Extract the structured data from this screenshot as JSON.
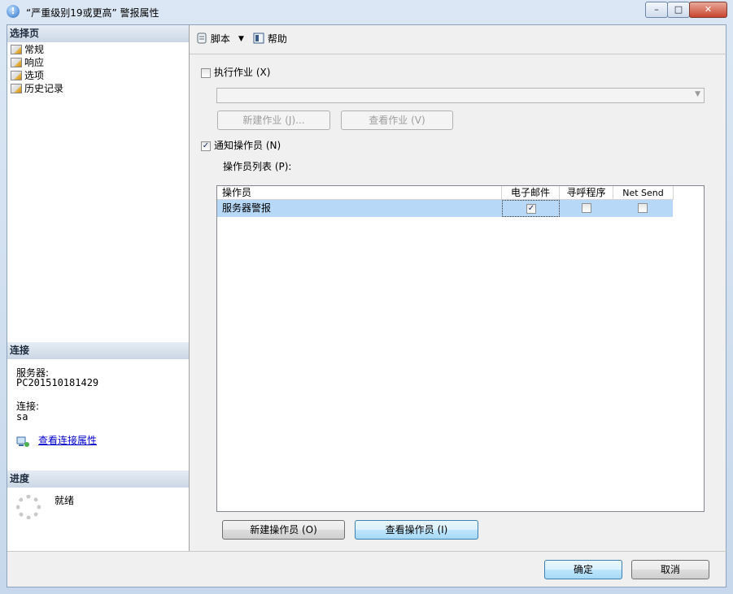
{
  "window": {
    "title": "“严重级别19或更高” 警报属性",
    "controls": {
      "minimize": "–",
      "maximize": "□",
      "close": "✕"
    }
  },
  "left_panel": {
    "select_page_header": "选择页",
    "pages": [
      {
        "label": "常规"
      },
      {
        "label": "响应"
      },
      {
        "label": "选项"
      },
      {
        "label": "历史记录"
      }
    ],
    "connection_header": "连接",
    "server_label": "服务器:",
    "server_value": "PC201510181429",
    "connection_label": "连接:",
    "connection_value": "sa",
    "view_connection_properties": "查看连接属性",
    "progress_header": "进度",
    "progress_status": "就绪"
  },
  "toolbar": {
    "script_label": "脚本",
    "help_label": "帮助",
    "icons": [
      "script-icon",
      "help-icon"
    ]
  },
  "response": {
    "execute_job_label": "执行作业 (X)",
    "execute_job_checked": false,
    "job_combo_value": "",
    "new_job_button": "新建作业 (J)...",
    "view_job_button": "查看作业 (V)",
    "notify_operators_label": "通知操作员 (N)",
    "notify_operators_checked": true,
    "operator_list_label": "操作员列表 (P):",
    "columns": [
      "操作员",
      "电子邮件",
      "寻呼程序",
      "Net Send"
    ],
    "rows": [
      {
        "operator": "服务器警报",
        "email": true,
        "pager": false,
        "net_send": false
      }
    ],
    "new_operator_button": "新建操作员 (O)",
    "view_operator_button": "查看操作员 (I)"
  },
  "footer": {
    "ok_button": "确定",
    "cancel_button": "取消"
  },
  "colors": {
    "selected_row": "#b7d8f7",
    "link": "#0000cc",
    "section_header": "#cbd7e5"
  }
}
